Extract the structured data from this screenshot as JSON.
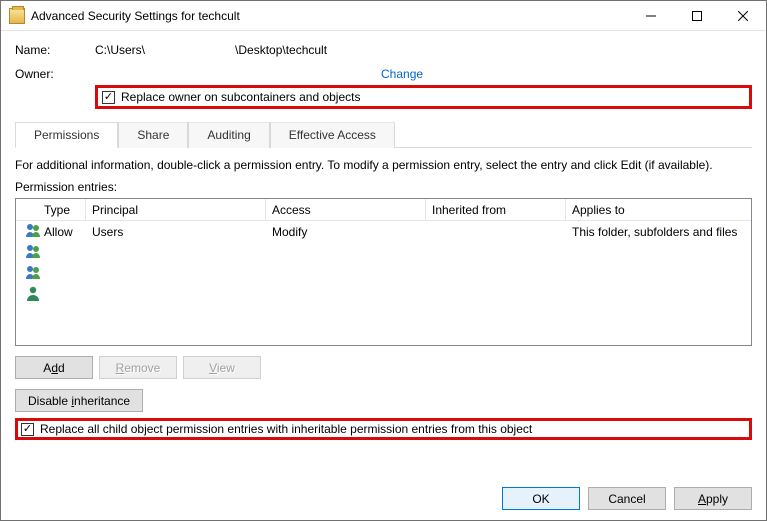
{
  "titlebar": {
    "title": "Advanced Security Settings for techcult"
  },
  "labels": {
    "name": "Name:",
    "owner": "Owner:",
    "change": "Change",
    "replace_owner": "Replace owner on subcontainers and objects",
    "info": "For additional information, double-click a permission entry. To modify a permission entry, select the entry and click Edit (if available).",
    "perm_entries": "Permission entries:",
    "replace_child": "Replace all child object permission entries with inheritable permission entries from this object"
  },
  "path": {
    "part1": "C:\\Users\\",
    "part2": "\\Desktop\\techcult"
  },
  "tabs": [
    {
      "label": "Permissions",
      "active": true
    },
    {
      "label": "Share",
      "active": false
    },
    {
      "label": "Auditing",
      "active": false
    },
    {
      "label": "Effective Access",
      "active": false
    }
  ],
  "grid": {
    "headers": {
      "type": "Type",
      "principal": "Principal",
      "access": "Access",
      "inherited": "Inherited from",
      "applies": "Applies to"
    },
    "rows": [
      {
        "icon": "group",
        "type": "Allow",
        "principal": "Users",
        "access": "Modify",
        "inherited": "",
        "applies": "This folder, subfolders and files"
      },
      {
        "icon": "group",
        "type": "",
        "principal": "",
        "access": "",
        "inherited": "",
        "applies": ""
      },
      {
        "icon": "group",
        "type": "",
        "principal": "",
        "access": "",
        "inherited": "",
        "applies": ""
      },
      {
        "icon": "single",
        "type": "",
        "principal": "",
        "access": "",
        "inherited": "",
        "applies": ""
      }
    ]
  },
  "buttons": {
    "add": "Add",
    "remove": "Remove",
    "view": "View",
    "disable_inh": "Disable inheritance",
    "ok": "OK",
    "cancel": "Cancel",
    "apply": "Apply"
  }
}
